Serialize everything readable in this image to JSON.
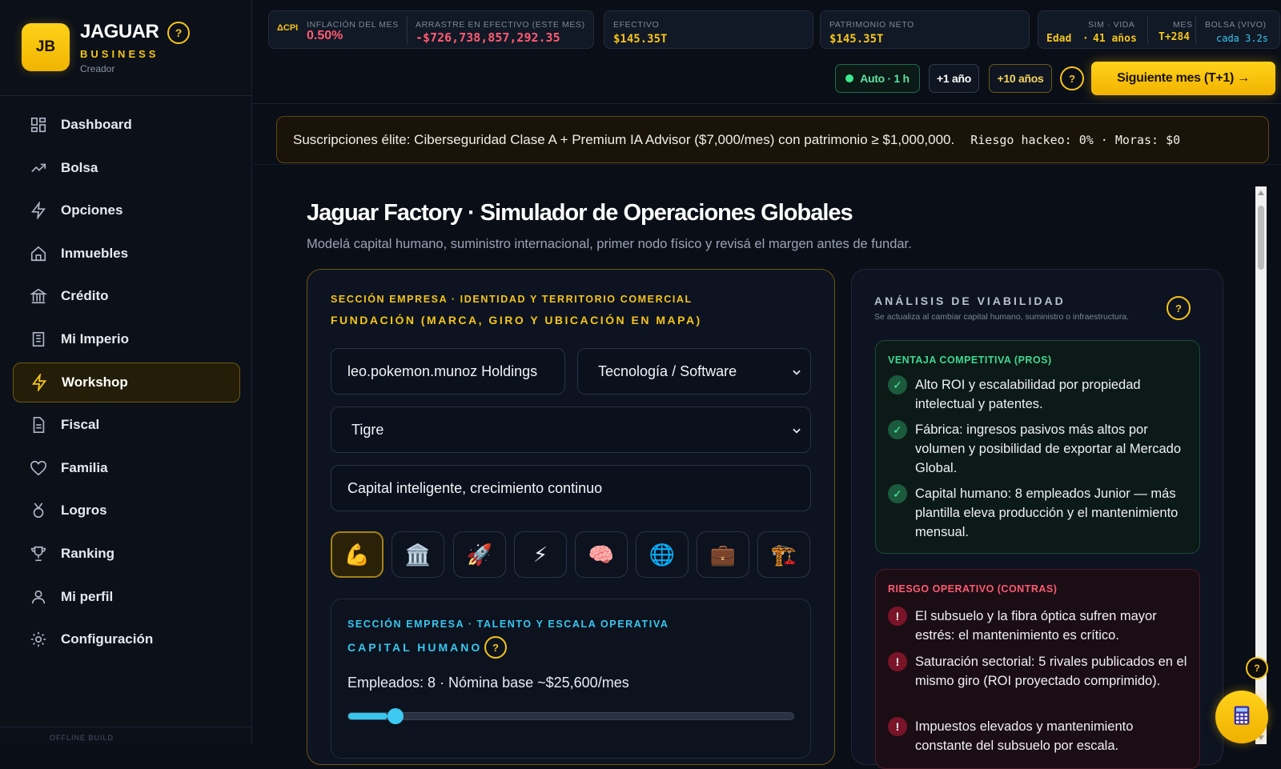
{
  "brand": {
    "logo": "JB",
    "name": "JAGUAR",
    "sub": "BUSINESS",
    "role": "Creador",
    "help": "?"
  },
  "nav": [
    {
      "label": "Dashboard",
      "icon": "dashboard-icon"
    },
    {
      "label": "Bolsa",
      "icon": "trending-up-icon"
    },
    {
      "label": "Opciones",
      "icon": "bolt-icon"
    },
    {
      "label": "Inmuebles",
      "icon": "home-icon"
    },
    {
      "label": "Crédito",
      "icon": "bank-icon"
    },
    {
      "label": "Mi Imperio",
      "icon": "building-icon"
    },
    {
      "label": "Workshop",
      "icon": "bolt-icon",
      "active": true
    },
    {
      "label": "Fiscal",
      "icon": "document-icon"
    },
    {
      "label": "Familia",
      "icon": "heart-icon"
    },
    {
      "label": "Logros",
      "icon": "medal-icon"
    },
    {
      "label": "Ranking",
      "icon": "trophy-icon"
    },
    {
      "label": "Mi perfil",
      "icon": "user-icon"
    },
    {
      "label": "Configuración",
      "icon": "gear-icon"
    }
  ],
  "footer": "OFFLINE BUILD",
  "topbar": {
    "cpi_badge": "ΔCPI",
    "inflation_label": "INFLACIÓN DEL MES",
    "inflation_value": "0.50%",
    "drag_label": "ARRASTRE EN EFECTIVO (ESTE MES)",
    "drag_value": "-$726,738,857,292.35",
    "cash_label": "EFECTIVO",
    "cash_value": "$145.35T",
    "networth_label": "PATRIMONIO NETO",
    "networth_value": "$145.35T",
    "sim_label": "SIM · VIDA",
    "sim_age_label": "Edad",
    "sim_age_value": "41 años",
    "month_label": "MES",
    "month_value": "T+284",
    "stock_label": "BOLSA (VIVO)",
    "stock_value": "cada 3.2s"
  },
  "controls": {
    "auto": "Auto · 1 h",
    "plus1": "+1 año",
    "plus10": "+10 años",
    "help": "?",
    "next": "Siguiente mes (T+1) →"
  },
  "banner": {
    "text": "Suscripciones élite: Ciberseguridad Clase A + Premium IA Advisor ($7,000/mes) con patrimonio ≥ $1,000,000.",
    "risk": "Riesgo hackeo: 0% · Moras: $0"
  },
  "page": {
    "title": "Jaguar Factory · Simulador de Operaciones Globales",
    "subtitle": "Modelá capital humano, suministro internacional, primer nodo físico y revisá el margen antes de fundar."
  },
  "identity": {
    "tag": "SECCIÓN EMPRESA · IDENTIDAD Y TERRITORIO COMERCIAL",
    "title": "FUNDACIÓN (MARCA, GIRO Y UBICACIÓN EN MAPA)",
    "company_name": "leo.pokemon.munoz Holdings",
    "sector": "Tecnología / Software",
    "location": "Tigre",
    "slogan": "Capital inteligente, crecimiento continuo",
    "icons": [
      "💪",
      "🏛️",
      "🚀",
      "⚡",
      "🧠",
      "🌐",
      "💼",
      "🏗️"
    ],
    "icon_names": [
      "muscle-icon",
      "bank-icon",
      "rocket-icon",
      "lightning-icon",
      "brain-icon",
      "globe-icon",
      "briefcase-icon",
      "construction-icon"
    ]
  },
  "talent": {
    "tag": "SECCIÓN EMPRESA · TALENTO Y ESCALA OPERATIVA",
    "title": "CAPITAL HUMANO",
    "help": "?",
    "employees": "Empleados: 8 · Nómina base ~$25,600/mes",
    "slider_fraction": 0.07
  },
  "viability": {
    "title": "ANÁLISIS DE VIABILIDAD",
    "subtitle": "Se actualiza al cambiar capital humano, suministro o infraestructura.",
    "help": "?",
    "pros_title": "VENTAJA COMPETITIVA (PROS)",
    "pros": [
      "Alto ROI y escalabilidad por propiedad intelectual y patentes.",
      "Fábrica: ingresos pasivos más altos por volumen y posibilidad de exportar al Mercado Global.",
      "Capital humano: 8 empleados Junior — más plantilla eleva producción y el mantenimiento mensual."
    ],
    "cons_title": "RIESGO OPERATIVO (CONTRAS)",
    "cons": [
      "El subsuelo y la fibra óptica sufren mayor estrés: el mantenimiento es crítico.",
      "Saturación sectorial: 5 rivales publicados en el mismo giro (ROI proyectado comprimido).",
      "Impuestos elevados y mantenimiento constante del subsuelo por escala."
    ]
  },
  "colors": {
    "accent": "#f5c518",
    "cyan": "#37c8f0",
    "pros": "#3fd892",
    "cons": "#ff5a72"
  }
}
